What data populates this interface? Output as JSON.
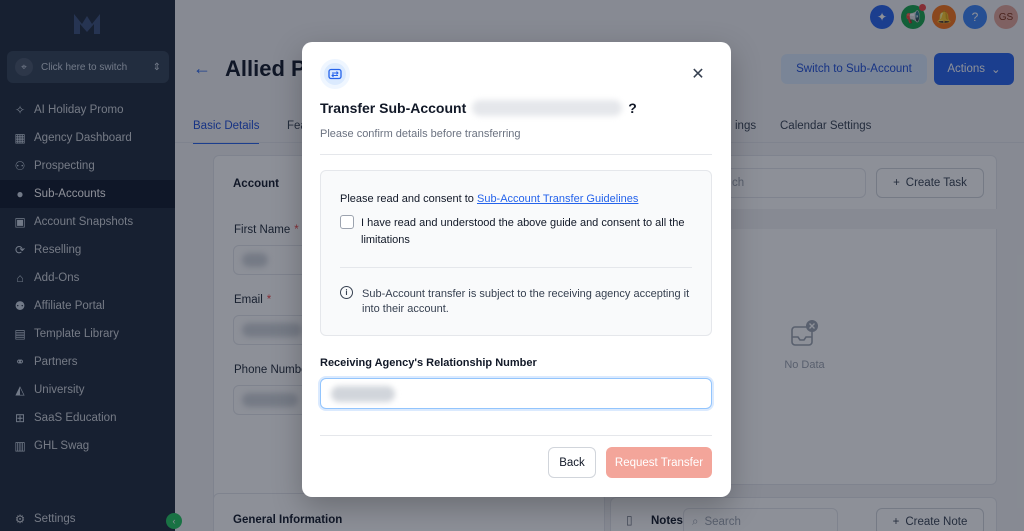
{
  "sidebar": {
    "switcher_label": "Click here to switch",
    "items": [
      {
        "icon": "sparkle-icon",
        "glyph": "✧",
        "label": "AI Holiday Promo"
      },
      {
        "icon": "dashboard-icon",
        "glyph": "▦",
        "label": "Agency Dashboard"
      },
      {
        "icon": "prospecting-icon",
        "glyph": "⚇",
        "label": "Prospecting"
      },
      {
        "icon": "user-icon",
        "glyph": "●",
        "label": "Sub-Accounts"
      },
      {
        "icon": "snapshot-icon",
        "glyph": "▣",
        "label": "Account Snapshots"
      },
      {
        "icon": "reselling-icon",
        "glyph": "⟳",
        "label": "Reselling"
      },
      {
        "icon": "bag-icon",
        "glyph": "⌂",
        "label": "Add-Ons"
      },
      {
        "icon": "users-icon",
        "glyph": "⚉",
        "label": "Affiliate Portal"
      },
      {
        "icon": "template-icon",
        "glyph": "▤",
        "label": "Template Library"
      },
      {
        "icon": "handshake-icon",
        "glyph": "⚭",
        "label": "Partners"
      },
      {
        "icon": "graduation-icon",
        "glyph": "◭",
        "label": "University"
      },
      {
        "icon": "education-icon",
        "glyph": "⊞",
        "label": "SaaS Education"
      },
      {
        "icon": "swag-icon",
        "glyph": "▥",
        "label": "GHL Swag"
      }
    ],
    "settings_label": "Settings",
    "active_index": 3
  },
  "topbar": {
    "avatar_initials": "GS",
    "help_glyph": "?"
  },
  "header": {
    "title": "Allied P",
    "switch_button": "Switch to Sub-Account",
    "actions_button": "Actions"
  },
  "tabs": {
    "basic": "Basic Details",
    "feat": "Fea",
    "ings": "ings",
    "calendar": "Calendar Settings"
  },
  "account_card": {
    "title": "Account",
    "first_name_label": "First Name",
    "email_label": "Email",
    "phone_label": "Phone Numbe",
    "required_mark": "*",
    "general_info_title": "General Information"
  },
  "tasks_card": {
    "search_fragment": "ch",
    "create_task": "Create Task",
    "no_data": "No Data"
  },
  "notes_card": {
    "title": "Notes",
    "search_placeholder": "Search",
    "create_note": "Create Note"
  },
  "modal": {
    "title_prefix": "Transfer Sub-Account",
    "title_suffix": "?",
    "subtitle": "Please confirm details before transferring",
    "consent_prefix": "Please read and consent to ",
    "consent_link": "Sub-Account Transfer Guidelines",
    "checkbox_label": "I have read and understood the above guide and consent to all the limitations",
    "info_text": "Sub-Account transfer is subject to the receiving agency accepting it into their account.",
    "relationship_label": "Receiving Agency's Relationship Number",
    "back_button": "Back",
    "request_button": "Request Transfer"
  },
  "colors": {
    "sidebar_bg": "#1e2a3b",
    "primary": "#2563eb",
    "request_button": "#f3a59a"
  }
}
